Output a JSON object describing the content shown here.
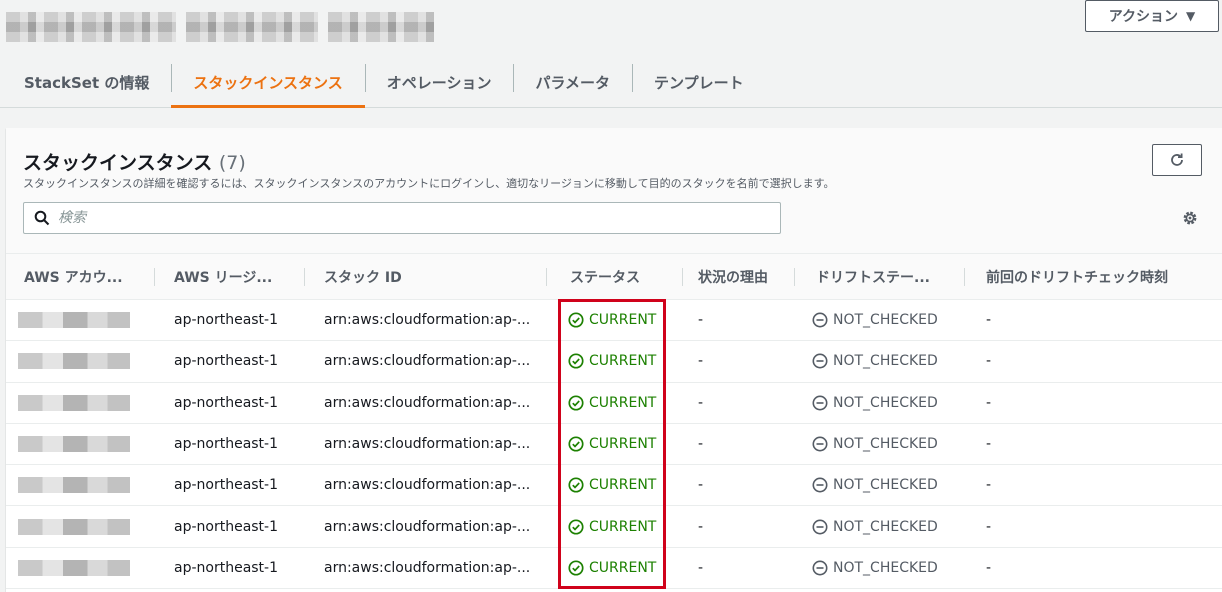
{
  "header": {
    "action_button": "アクション",
    "caret_icon": "caret-down-icon"
  },
  "tabs": [
    {
      "label": "StackSet の情報",
      "active": false
    },
    {
      "label": "スタックインスタンス",
      "active": true
    },
    {
      "label": "オペレーション",
      "active": false
    },
    {
      "label": "パラメータ",
      "active": false
    },
    {
      "label": "テンプレート",
      "active": false
    }
  ],
  "panel": {
    "title": "スタックインスタンス",
    "count": "(7)",
    "description": "スタックインスタンスの詳細を確認するには、スタックインスタンスのアカウントにログインし、適切なリージョンに移動して目的のスタックを名前で選択します。",
    "search_placeholder": "検索"
  },
  "table": {
    "columns": [
      "AWS アカウ...",
      "AWS リージ...",
      "スタック ID",
      "ステータス",
      "状況の理由",
      "ドリフトステー...",
      "前回のドリフトチェック時刻"
    ],
    "rows": [
      {
        "region": "ap-northeast-1",
        "stack_id": "arn:aws:cloudformation:ap-...",
        "status": "CURRENT",
        "reason": "-",
        "drift": "NOT_CHECKED",
        "last_drift": "-"
      },
      {
        "region": "ap-northeast-1",
        "stack_id": "arn:aws:cloudformation:ap-...",
        "status": "CURRENT",
        "reason": "-",
        "drift": "NOT_CHECKED",
        "last_drift": "-"
      },
      {
        "region": "ap-northeast-1",
        "stack_id": "arn:aws:cloudformation:ap-...",
        "status": "CURRENT",
        "reason": "-",
        "drift": "NOT_CHECKED",
        "last_drift": "-"
      },
      {
        "region": "ap-northeast-1",
        "stack_id": "arn:aws:cloudformation:ap-...",
        "status": "CURRENT",
        "reason": "-",
        "drift": "NOT_CHECKED",
        "last_drift": "-"
      },
      {
        "region": "ap-northeast-1",
        "stack_id": "arn:aws:cloudformation:ap-...",
        "status": "CURRENT",
        "reason": "-",
        "drift": "NOT_CHECKED",
        "last_drift": "-"
      },
      {
        "region": "ap-northeast-1",
        "stack_id": "arn:aws:cloudformation:ap-...",
        "status": "CURRENT",
        "reason": "-",
        "drift": "NOT_CHECKED",
        "last_drift": "-"
      },
      {
        "region": "ap-northeast-1",
        "stack_id": "arn:aws:cloudformation:ap-...",
        "status": "CURRENT",
        "reason": "-",
        "drift": "NOT_CHECKED",
        "last_drift": "-"
      }
    ]
  },
  "colors": {
    "accent": "#ec7211",
    "success": "#1d8102",
    "highlight": "#d0021b"
  }
}
